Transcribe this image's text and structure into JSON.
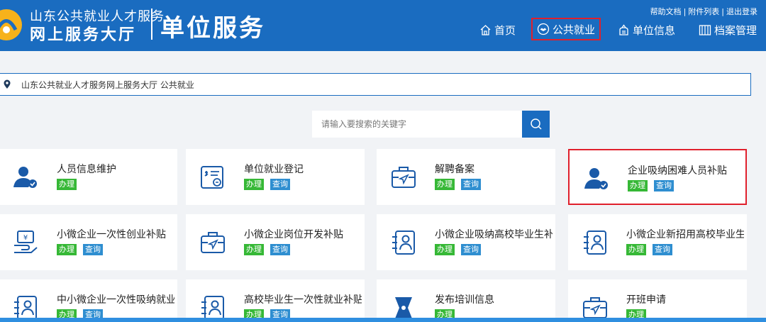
{
  "header": {
    "logo_line1": "山东公共就业人才服务",
    "logo_line2": "网上服务大厅",
    "site_title": "单位服务",
    "top_links": [
      "帮助文档",
      "附件列表",
      "退出登录"
    ],
    "top_sep": "|",
    "nav": {
      "home": "首页",
      "public": "公共就业",
      "unit": "单位信息",
      "archive": "档案管理"
    }
  },
  "breadcrumb": "山东公共就业人才服务网上服务大厅 公共就业",
  "search": {
    "placeholder": "请输入要搜索的关键字"
  },
  "cards": [
    {
      "title": "人员信息维护",
      "icon": "person-icon",
      "badges": [
        "办理"
      ]
    },
    {
      "title": "单位就业登记",
      "icon": "register-form-icon",
      "badges": [
        "办理",
        "查询"
      ]
    },
    {
      "title": "解聘备案",
      "icon": "briefcase-icon",
      "badges": [
        "办理",
        "查询"
      ]
    },
    {
      "title": "企业吸纳困难人员补贴",
      "icon": "person-icon",
      "badges": [
        "办理",
        "查询"
      ]
    },
    {
      "title": "小微企业一次性创业补贴",
      "icon": "money-hand-icon",
      "badges": [
        "办理",
        "查询"
      ]
    },
    {
      "title": "小微企业岗位开发补贴",
      "icon": "briefcase-icon",
      "badges": [
        "办理",
        "查询"
      ]
    },
    {
      "title": "小微企业吸纳高校毕业生补贴",
      "icon": "contact-card-icon",
      "badges": [
        "办理",
        "查询"
      ]
    },
    {
      "title": "小微企业新招用高校毕业生一次",
      "icon": "contact-card-icon",
      "badges": [
        "办理",
        "查询"
      ]
    },
    {
      "title": "中小微企业一次性吸纳就业补贴",
      "icon": "contact-card-icon",
      "badges": [
        "办理",
        "查询"
      ]
    },
    {
      "title": "高校毕业生一次性就业补贴",
      "icon": "contact-card-icon",
      "badges": [
        "办理",
        "查询"
      ]
    },
    {
      "title": "发布培训信息",
      "icon": "training-icon",
      "badges": [
        "办理"
      ]
    },
    {
      "title": "开班申请",
      "icon": "briefcase-icon",
      "badges": [
        "办理"
      ]
    }
  ],
  "colors": {
    "header_bg": "#1a6cc0",
    "do_badge": "#36b836",
    "query_badge": "#2e8ed0",
    "highlight": "#e0202c"
  }
}
